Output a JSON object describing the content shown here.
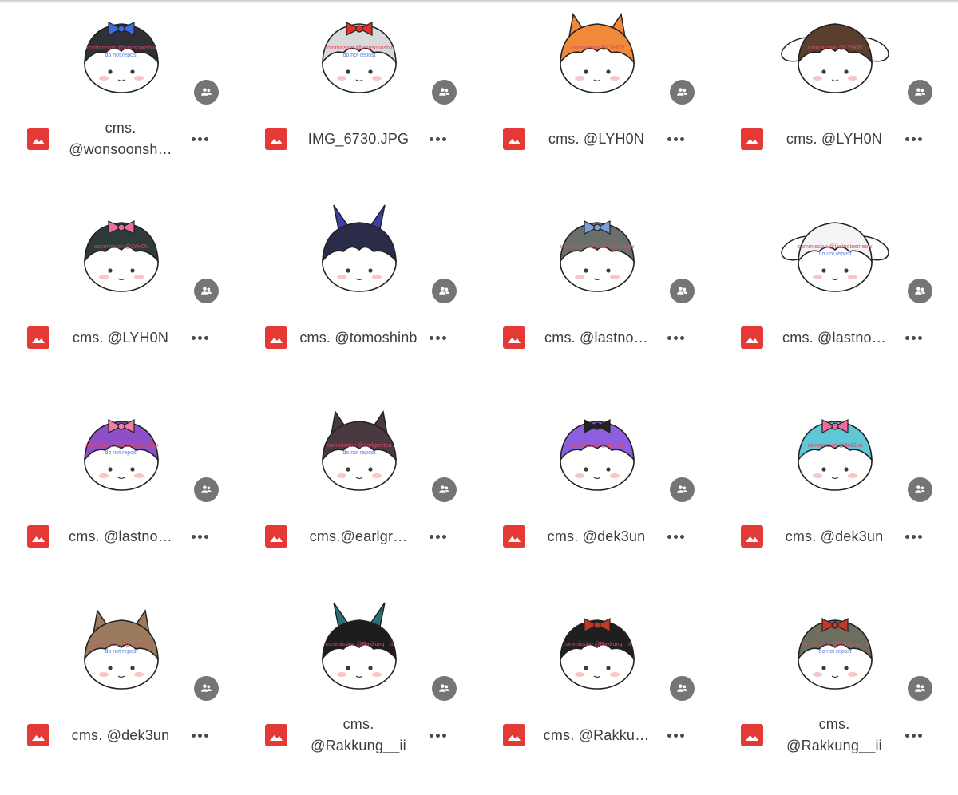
{
  "files": [
    {
      "name": "cms. @wonsoonsh…",
      "hair": "#2f3137",
      "accent": "#3b6fe0",
      "ears": "none",
      "watermark": "commission @wonsoonshin\ndo not repost"
    },
    {
      "name": "IMG_6730.JPG",
      "hair": "#d9d9d9",
      "accent": "#e0302c",
      "ears": "none",
      "watermark": "commission @wonsoonshin\ndo not repost"
    },
    {
      "name": "cms. @LYH0N",
      "hair": "#f0893a",
      "accent": "#222222",
      "ears": "cat",
      "watermark": "commission @LYH0N"
    },
    {
      "name": "cms. @LYH0N",
      "hair": "#5a3f2e",
      "accent": "#ffffff",
      "ears": "bunny",
      "watermark": "commission @LYH0N"
    },
    {
      "name": "cms. @LYH0N",
      "hair": "#2f3a3a",
      "accent": "#f06ba3",
      "ears": "none",
      "watermark": "commission @LYH0N"
    },
    {
      "name": "cms. @tomoshinb",
      "hair": "#2b2b4a",
      "accent": "#3c3fa8",
      "ears": "horns",
      "watermark": ""
    },
    {
      "name": "cms. @lastno…",
      "hair": "#6b6f6a",
      "accent": "#7aa0d8",
      "ears": "none",
      "watermark": "commission @lastnotesmeow"
    },
    {
      "name": "cms. @lastno…",
      "hair": "#f4f4f4",
      "accent": "#6fa8f0",
      "ears": "bunny",
      "watermark": "commission @lastnotesmeow\ndo not repost"
    },
    {
      "name": "cms. @lastno…",
      "hair": "#8f4fc8",
      "accent": "#f07fa0",
      "ears": "none",
      "watermark": "commission @lastnotesmeow\ndo not repost"
    },
    {
      "name": "cms.@earlgr…",
      "hair": "#4a3a40",
      "accent": "#6a5a60",
      "ears": "cat",
      "watermark": "commission @earlgreytea\ndo not repost"
    },
    {
      "name": "cms. @dek3un",
      "hair": "#8e5ee0",
      "accent": "#222222",
      "ears": "none",
      "watermark": "commission @dek3un"
    },
    {
      "name": "cms. @dek3un",
      "hair": "#5ec8d6",
      "accent": "#f06ba3",
      "ears": "none",
      "watermark": "commission @dek3un"
    },
    {
      "name": "cms. @dek3un",
      "hair": "#9b7a5e",
      "accent": "#c08d6a",
      "ears": "cat",
      "watermark": "commission @dek3un\ndo not repost"
    },
    {
      "name": "cms. @Rakkung__ii",
      "hair": "#1d1d1d",
      "accent": "#2a6f7a",
      "ears": "horns",
      "watermark": "commission @Rakkung__ii"
    },
    {
      "name": "cms. @Rakku…",
      "hair": "#1f1f1f",
      "accent": "#c0392b",
      "ears": "none",
      "watermark": "commission @Rakkung__ii"
    },
    {
      "name": "cms. @Rakkung__ii",
      "hair": "#6e6e5e",
      "accent": "#c0392b",
      "ears": "none",
      "watermark": "commission @Rakkung__ii\ndo not repost"
    }
  ],
  "colors": {
    "file_icon_bg": "#e53935",
    "share_badge_bg": "#757575",
    "filename_text": "#3c3c3c",
    "more_dots": "#4a4a4a"
  },
  "icons": {
    "file_type": "image-file-icon",
    "shared": "people-icon",
    "more": "more-horizontal-icon"
  }
}
